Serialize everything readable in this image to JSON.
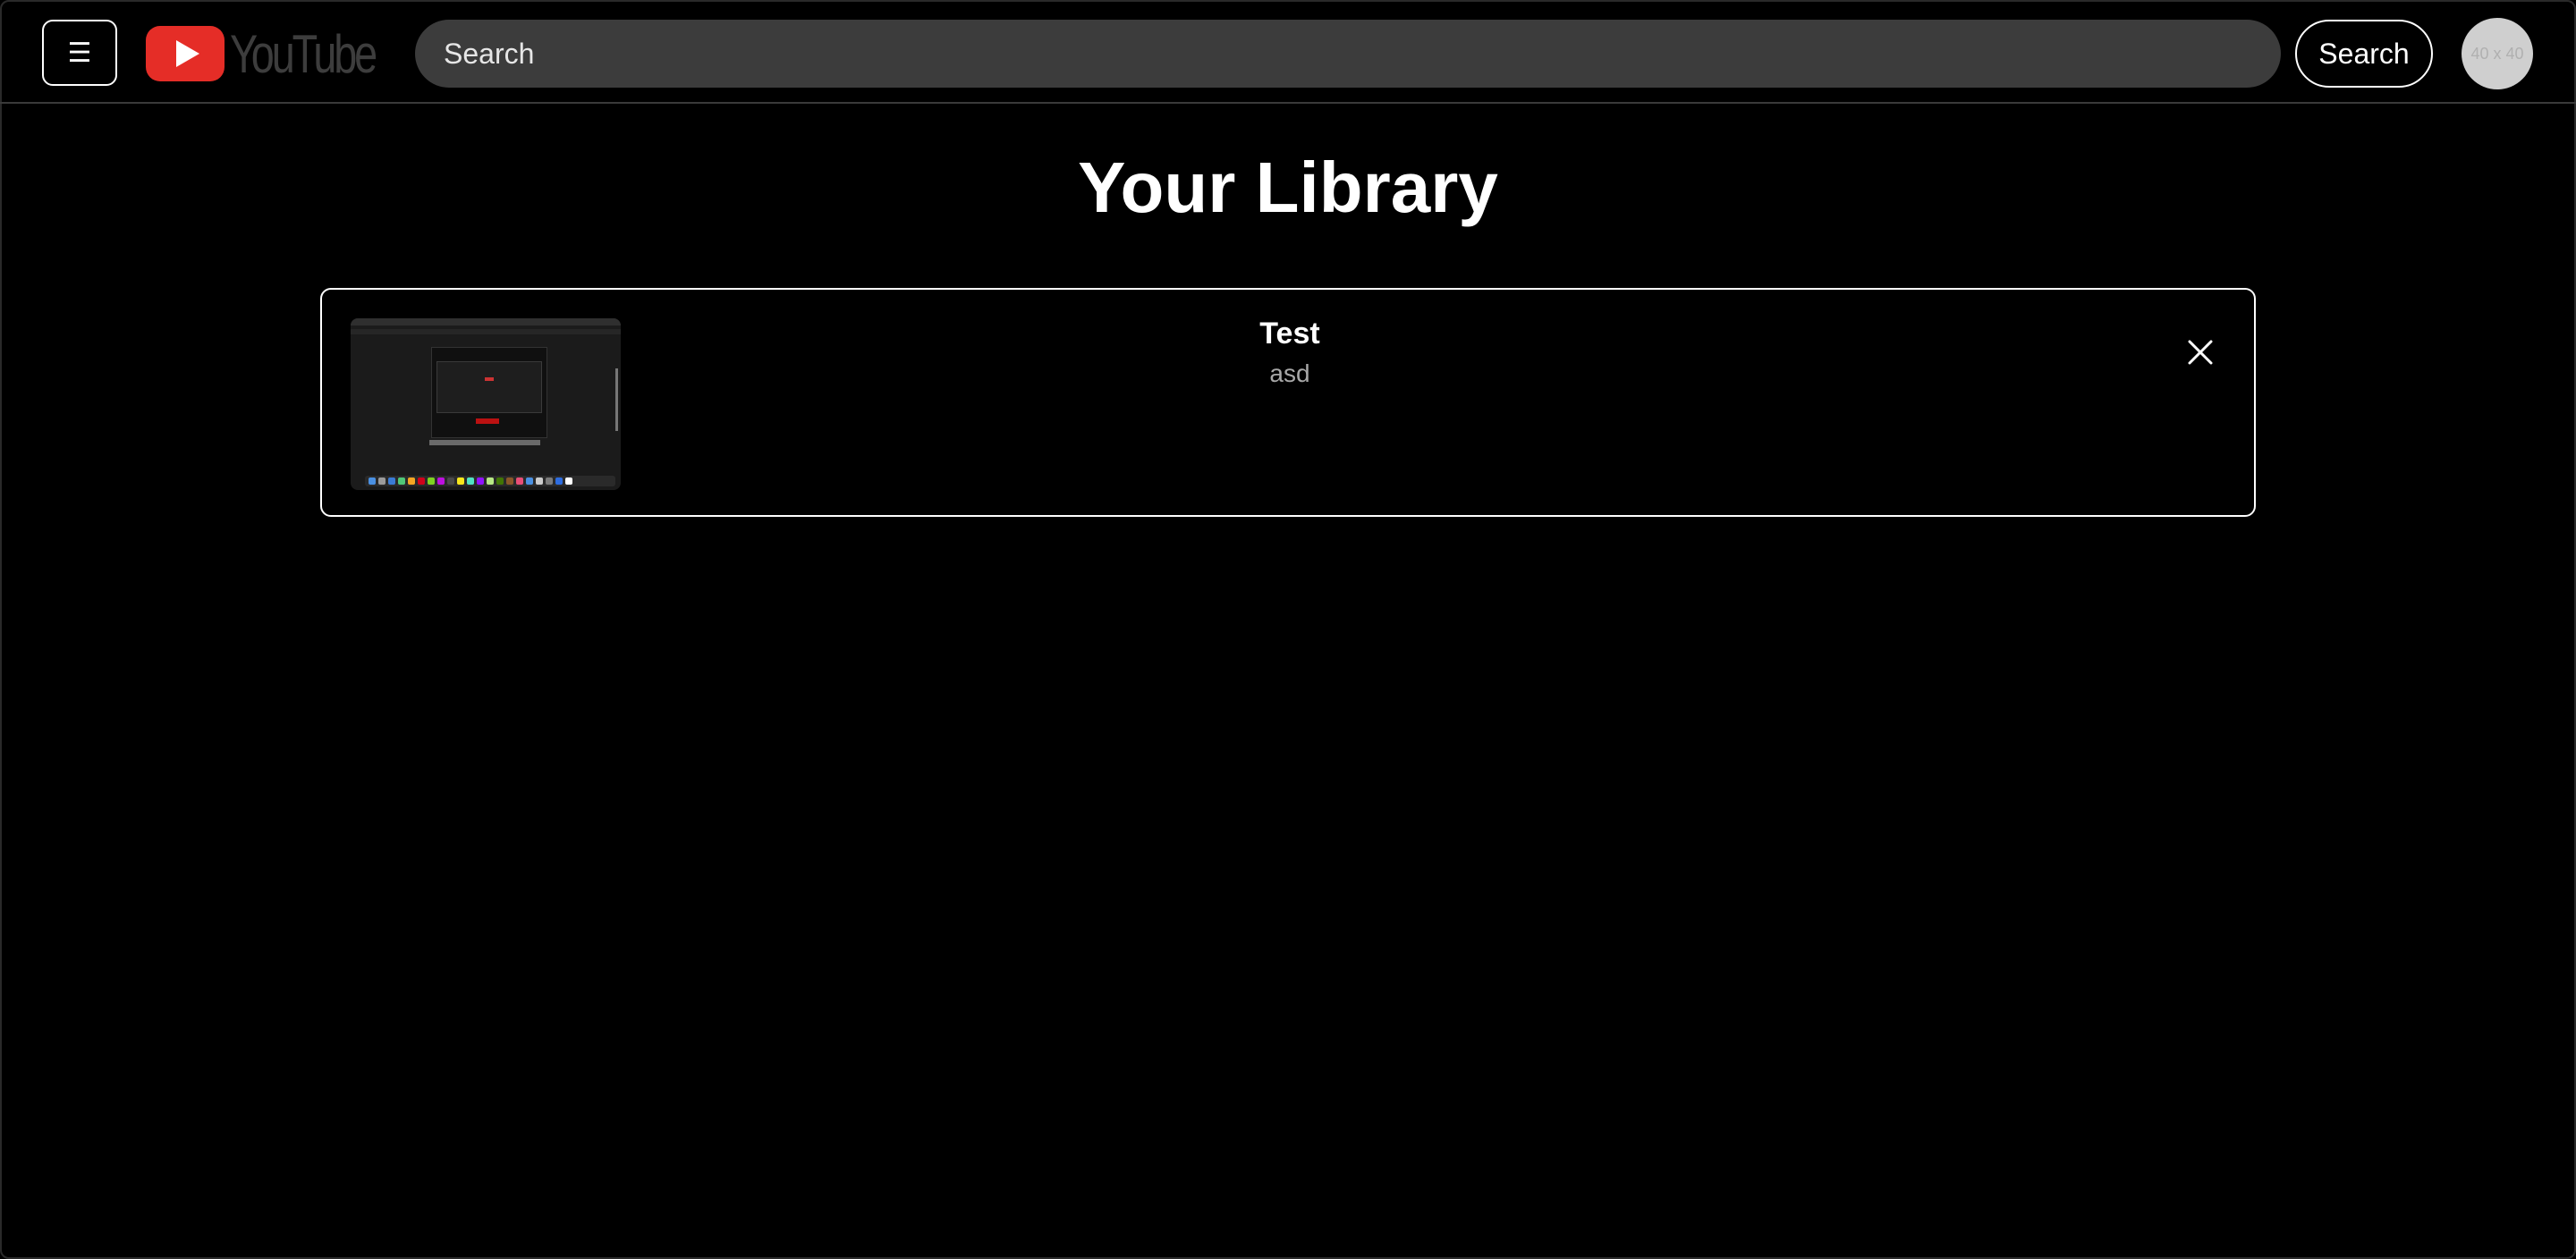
{
  "header": {
    "menu_icon": "hamburger-menu-icon",
    "logo_text": "YouTube",
    "logo_color": "#ff0000",
    "search": {
      "placeholder": "Search",
      "value": ""
    },
    "search_button_label": "Search",
    "avatar_text": "40 x 40"
  },
  "main": {
    "title": "Your Library",
    "items": [
      {
        "title": "Test",
        "subtitle": "asd",
        "thumbnail_icon": "video-thumbnail",
        "remove_icon": "close-icon"
      }
    ]
  }
}
